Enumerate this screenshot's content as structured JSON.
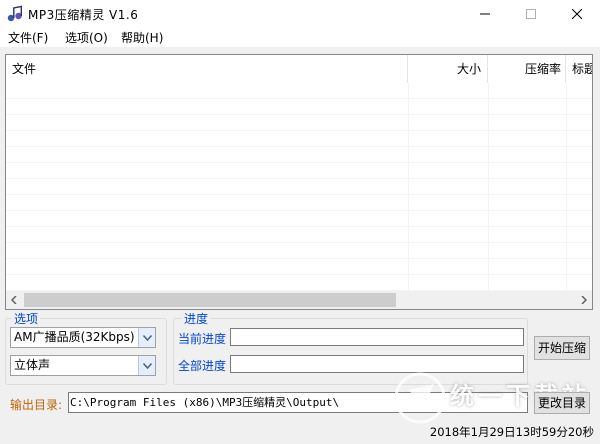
{
  "window": {
    "title": "MP3压缩精灵 V1.6"
  },
  "menu": [
    {
      "label": "文件(F)"
    },
    {
      "label": "选项(O)"
    },
    {
      "label": "帮助(H)"
    }
  ],
  "file_list": {
    "columns": [
      "文件",
      "大小",
      "压缩率",
      "标题"
    ],
    "rows": []
  },
  "options": {
    "group_label": "选项",
    "quality_selected": "AM广播品质(32Kbps)",
    "channel_selected": "立体声"
  },
  "progress": {
    "group_label": "进度",
    "current_label": "当前进度",
    "total_label": "全部进度",
    "current_value": 0,
    "total_value": 0
  },
  "buttons": {
    "start": "开始压缩",
    "change_dir": "更改目录"
  },
  "output": {
    "label": "输出目录:",
    "path": "C:\\Program Files (x86)\\MP3压缩精灵\\Output\\"
  },
  "status": {
    "text": "2018年1月29日13时59分20秒"
  },
  "watermark": {
    "text": "统一下载站"
  },
  "colors": {
    "accent_blue": "#0046d5",
    "output_label": "#c0630a"
  },
  "icons": {
    "app": "music-note-icon",
    "minimize": "minimize-icon",
    "maximize": "maximize-icon",
    "close": "close-icon"
  }
}
